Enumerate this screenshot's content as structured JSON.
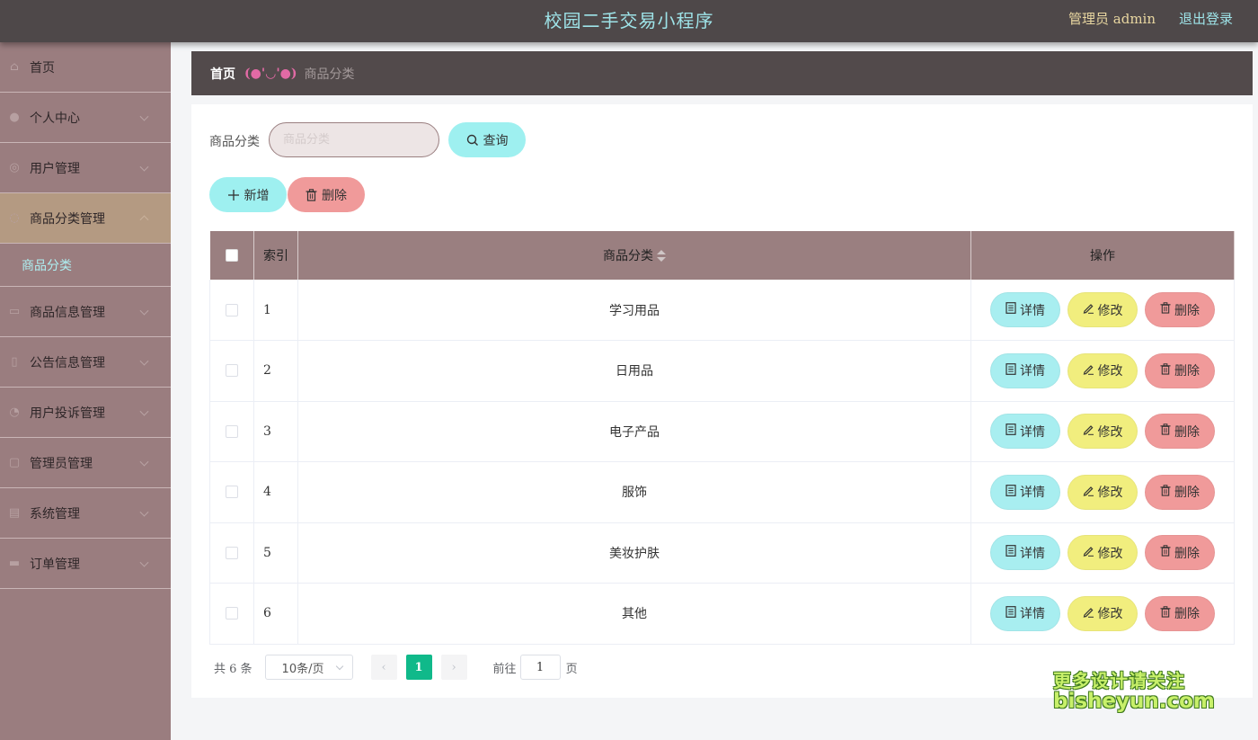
{
  "header": {
    "title": "校园二手交易小程序",
    "admin_label": "管理员 admin",
    "logout": "退出登录"
  },
  "sidebar": {
    "items": [
      {
        "label": "首页",
        "icon": "home-icon",
        "glyph": "⌂"
      },
      {
        "label": "个人中心",
        "icon": "user-icon",
        "glyph": "●"
      },
      {
        "label": "用户管理",
        "icon": "globe-icon",
        "glyph": "◎"
      },
      {
        "label": "商品分类管理",
        "icon": "compass-icon",
        "glyph": "◌",
        "active": true,
        "submenu": [
          "商品分类"
        ]
      },
      {
        "label": "商品信息管理",
        "icon": "window-icon",
        "glyph": "▭"
      },
      {
        "label": "公告信息管理",
        "icon": "document-icon",
        "glyph": "▯"
      },
      {
        "label": "用户投诉管理",
        "icon": "power-icon",
        "glyph": "◔"
      },
      {
        "label": "管理员管理",
        "icon": "frame-icon",
        "glyph": "▢"
      },
      {
        "label": "系统管理",
        "icon": "briefcase-icon",
        "glyph": "▤"
      },
      {
        "label": "订单管理",
        "icon": "folder-icon",
        "glyph": "▬"
      }
    ]
  },
  "breadcrumb": {
    "home": "首页",
    "separator": "(●'◡'●)",
    "current": "商品分类"
  },
  "search": {
    "label": "商品分类",
    "placeholder": "商品分类",
    "button": "查询"
  },
  "actions": {
    "add": "新增",
    "delete": "删除"
  },
  "table": {
    "columns": [
      "索引",
      "商品分类",
      "操作"
    ],
    "rows": [
      {
        "index": "1",
        "name": "学习用品"
      },
      {
        "index": "2",
        "name": "日用品"
      },
      {
        "index": "3",
        "name": "电子产品"
      },
      {
        "index": "4",
        "name": "服饰"
      },
      {
        "index": "5",
        "name": "美妆护肤"
      },
      {
        "index": "6",
        "name": "其他"
      }
    ],
    "row_actions": {
      "detail": "详情",
      "edit": "修改",
      "delete": "删除"
    }
  },
  "pagination": {
    "total": "共 6 条",
    "page_size": "10条/页",
    "current_page": "1",
    "prev": "‹",
    "next": "›",
    "goto_label": "前往",
    "goto_value": "1",
    "page_suffix": "页"
  },
  "watermark": {
    "line1": "更多设计请关注",
    "line2": "bisheyun.com"
  },
  "colors": {
    "topbar": "#4e4849",
    "sidebar": "#9a7d7f",
    "accent_cyan": "#9ef0f0",
    "accent_yellow": "#f1ee7e",
    "accent_red": "#f09a9a",
    "pager_active": "#10b98a"
  }
}
